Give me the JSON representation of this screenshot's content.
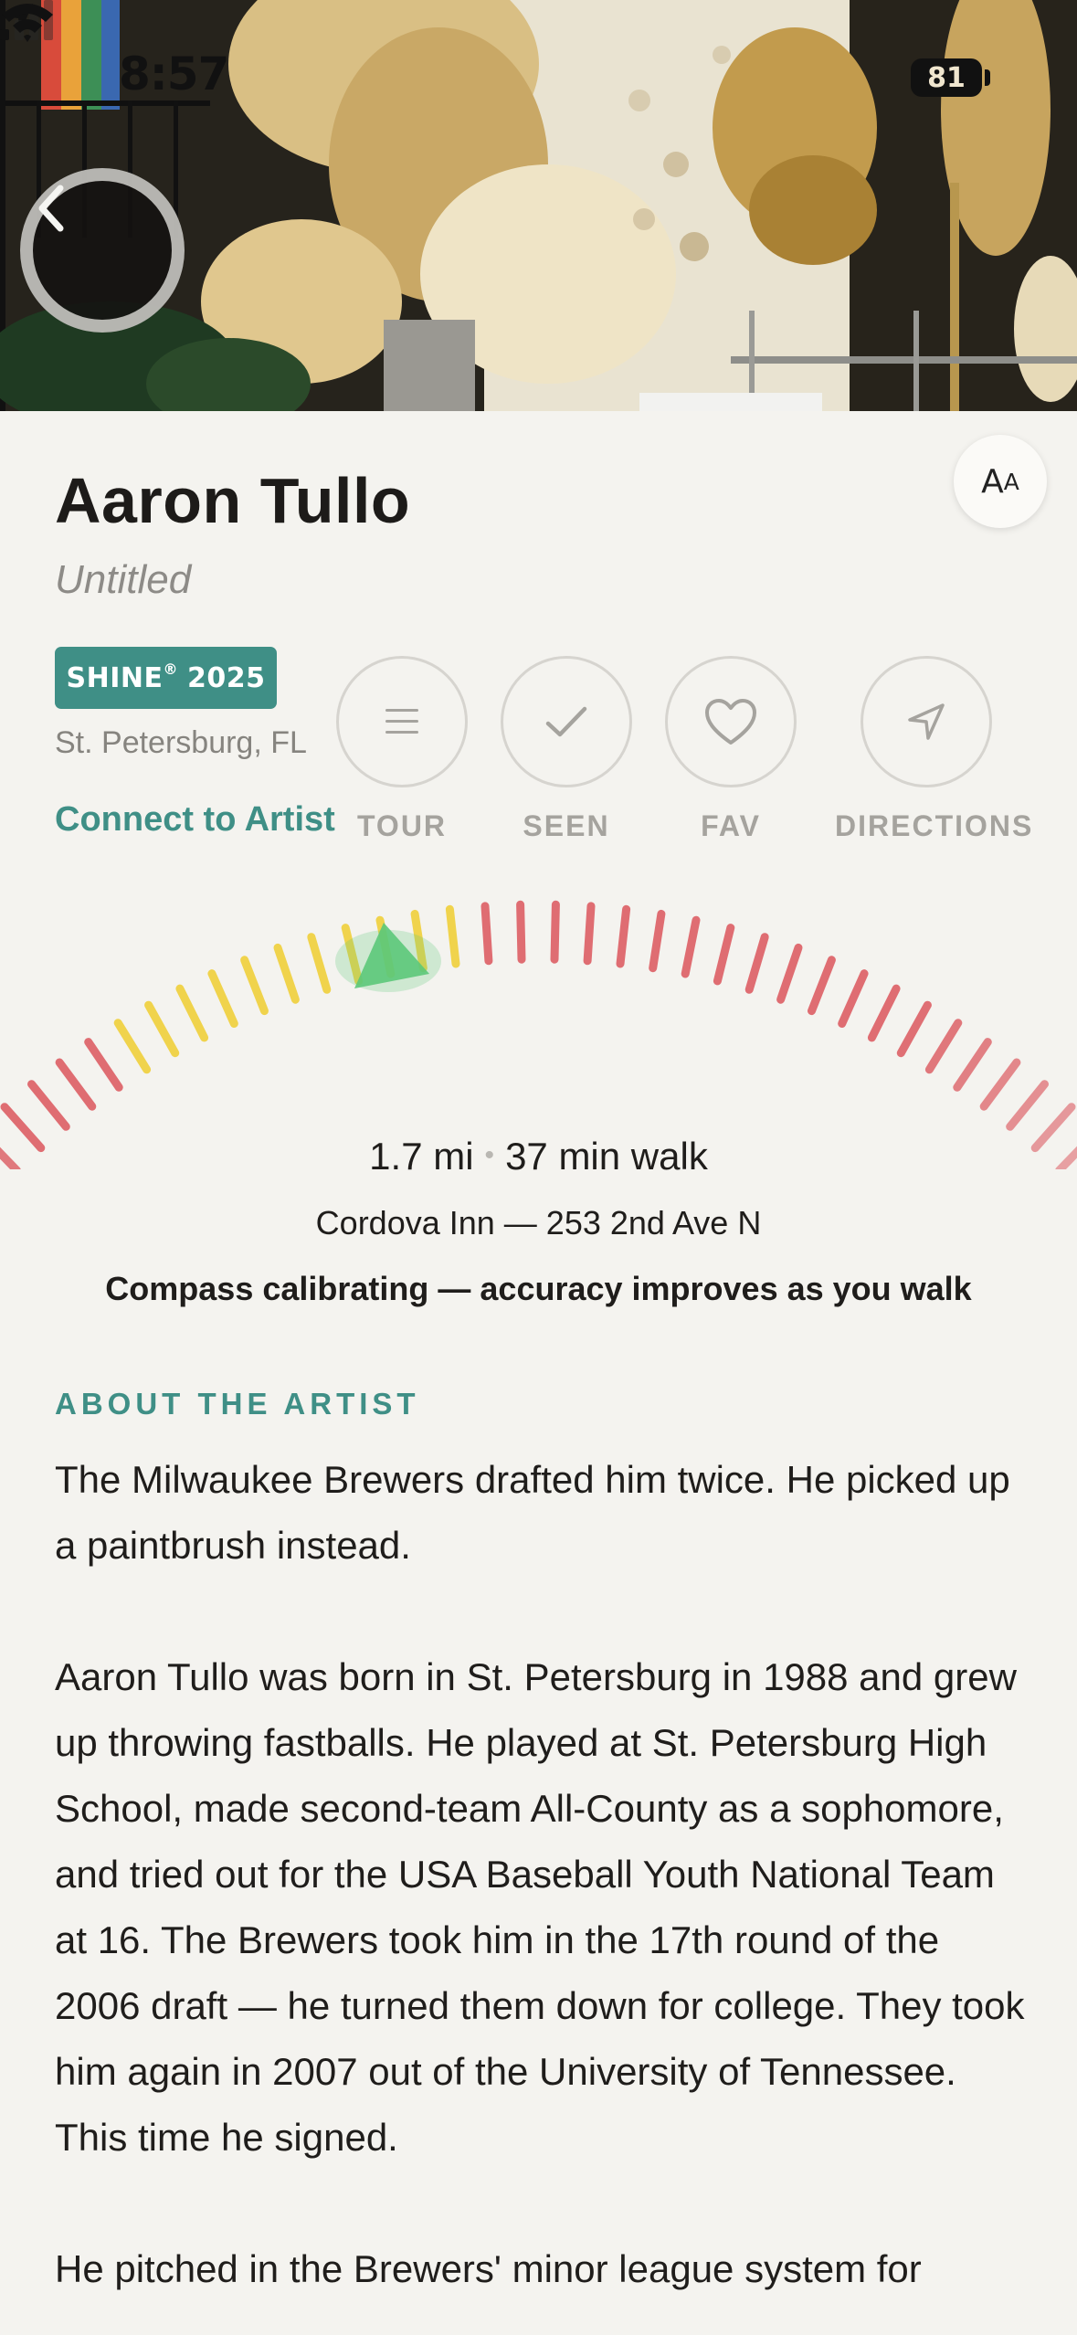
{
  "status_bar": {
    "time": "8:57",
    "battery": "81"
  },
  "header": {
    "artist_name": "Aaron Tullo",
    "artwork_title": "Untitled",
    "text_size_button": {
      "big": "A",
      "small": "A"
    },
    "badge": {
      "prefix": "SHINE",
      "reg": "®",
      "year": "2025"
    },
    "location": "St. Petersburg, FL",
    "connect_label": "Connect to Artist"
  },
  "actions": [
    {
      "label": "TOUR",
      "icon": "menu-icon"
    },
    {
      "label": "SEEN",
      "icon": "check-icon"
    },
    {
      "label": "FAV",
      "icon": "heart-icon"
    },
    {
      "label": "DIRECTIONS",
      "icon": "navigation-arrow-icon"
    }
  ],
  "compass": {
    "distance": "1.7 mi",
    "separator": "•",
    "walk_time": "37 min walk",
    "address": "Cordova Inn — 253 2nd Ave N",
    "calibration_note": "Compass calibrating — accuracy improves as you walk",
    "colors": {
      "green": "#5cc879",
      "yellow": "#f0d34c",
      "red": "#df6d72"
    }
  },
  "about": {
    "heading": "ABOUT THE ARTIST",
    "paragraphs": [
      "The Milwaukee Brewers drafted him twice. He picked up a paintbrush instead.",
      "Aaron Tullo was born in St. Petersburg in 1988 and grew up throwing fastballs. He played at St. Petersburg High School, made second-team All-County as a sophomore, and tried out for the USA Baseball Youth National Team at 16. The Brewers took him in the 17th round of the 2006 draft — he turned them down for college. They took him again in 2007 out of the University of Tennessee. This time he signed.",
      "He pitched in the Brewers' minor league system for"
    ]
  },
  "colors": {
    "accent": "#3f8f86",
    "background": "#f4f3ef"
  }
}
